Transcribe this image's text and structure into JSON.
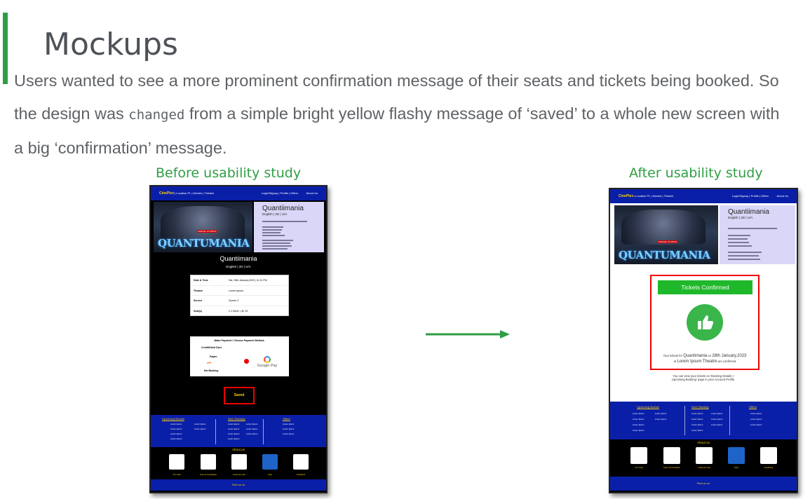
{
  "slide": {
    "title": "Mockups",
    "body_part1": "Users wanted to see a more prominent confirmation message of their seats and tickets being booked. So the design was ",
    "body_mono": "changed",
    "body_part2": " from a simple bright yellow flashy message of ‘saved’ to a whole new screen with a big ‘confirmation’ message.",
    "caption_before": "Before usability study",
    "caption_after": "After usability study",
    "accent_color": "#2f9e44"
  },
  "nav": {
    "brand": "CinePlex",
    "left_links": "| Location Pt. | Movies | Theatre",
    "right_links": "Login/Signup | Profile | Offers",
    "about": "About Us"
  },
  "movie": {
    "title": "Quantiimania",
    "subtitle": "English | 2D | U/A",
    "poster_logo": "QUANTUMANIA",
    "poster_badge": "MARVEL STUDIOS"
  },
  "before": {
    "details": [
      {
        "label": "Date & Time",
        "value": "Sat, 28th January,2023 | 11:11 PM"
      },
      {
        "label": "Theatre",
        "value": "Lorem Ipsum"
      },
      {
        "label": "Screen",
        "value": "Screen 2"
      },
      {
        "label": "Seat(s)",
        "value": "2 x Silver | J8, J9"
      }
    ],
    "payment_title": "Make Payment / Choose Payment Method-",
    "payment_options": [
      "Credit/Debit Card",
      "Paytm",
      "UPI",
      "Net Banking"
    ],
    "gpay": "Google Pay",
    "saved_label": "Saved"
  },
  "after": {
    "banner": "Tickets Confirmed",
    "msg_prefix": "Your tickets for ",
    "msg_movie": "Quantimania",
    "msg_on": " on ",
    "msg_date": "28th January,2023",
    "msg_at": "at ",
    "msg_theatre": "Lorem Ipsum Theatre",
    "msg_suffix": " are confirmed",
    "view_note_1": "You can view your tickets on ‘Booking Details >",
    "view_note_2": "Upcoming Booking’ page in your Account Profile."
  },
  "footer": {
    "headings": [
      "Upcoming Movies",
      "Now Showing",
      "Offers"
    ],
    "item": "Lorem Ipsum",
    "about_us": "About us",
    "about_labels": [
      "Our Goal",
      "Team & Foundation",
      "Customer care",
      "FAQ",
      "Feedback"
    ],
    "find_us": "Find us on"
  }
}
